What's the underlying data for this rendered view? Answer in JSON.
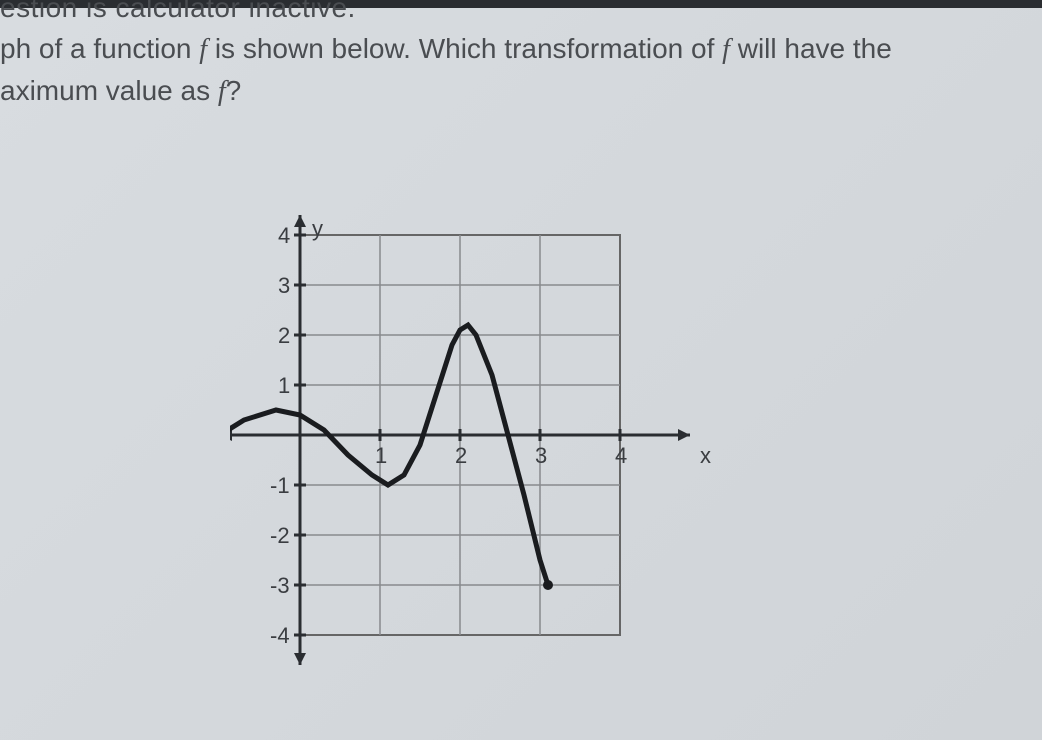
{
  "notice": "estion is calculator inactive.",
  "question_line1_part1": "ph of a function ",
  "question_line1_f": "f",
  "question_line1_part2": " is shown below. Which transformation of ",
  "question_line1_f2": "f",
  "question_line1_part3": " will have the",
  "question_line2_part1": "aximum value as ",
  "question_line2_f": "f",
  "question_line2_part2": "?",
  "chart_data": {
    "type": "line",
    "title": "",
    "xlabel": "x",
    "ylabel": "y",
    "xlim": [
      -1,
      4.5
    ],
    "ylim": [
      -4.5,
      4.5
    ],
    "x_ticks": [
      1,
      2,
      3,
      4
    ],
    "y_ticks_pos": [
      1,
      2,
      3,
      4
    ],
    "y_ticks_neg": [
      -1,
      -2,
      -3,
      -4
    ],
    "grid": true,
    "curve_points": [
      {
        "x": -1.0,
        "y": 0.0
      },
      {
        "x": -0.7,
        "y": 0.3
      },
      {
        "x": -0.3,
        "y": 0.5
      },
      {
        "x": 0.0,
        "y": 0.4
      },
      {
        "x": 0.3,
        "y": 0.1
      },
      {
        "x": 0.6,
        "y": -0.4
      },
      {
        "x": 0.9,
        "y": -0.8
      },
      {
        "x": 1.1,
        "y": -1.0
      },
      {
        "x": 1.3,
        "y": -0.8
      },
      {
        "x": 1.5,
        "y": -0.2
      },
      {
        "x": 1.7,
        "y": 0.8
      },
      {
        "x": 1.9,
        "y": 1.8
      },
      {
        "x": 2.0,
        "y": 2.1
      },
      {
        "x": 2.1,
        "y": 2.2
      },
      {
        "x": 2.2,
        "y": 2.0
      },
      {
        "x": 2.4,
        "y": 1.2
      },
      {
        "x": 2.6,
        "y": 0.0
      },
      {
        "x": 2.8,
        "y": -1.2
      },
      {
        "x": 3.0,
        "y": -2.5
      },
      {
        "x": 3.1,
        "y": -3.0
      }
    ]
  }
}
